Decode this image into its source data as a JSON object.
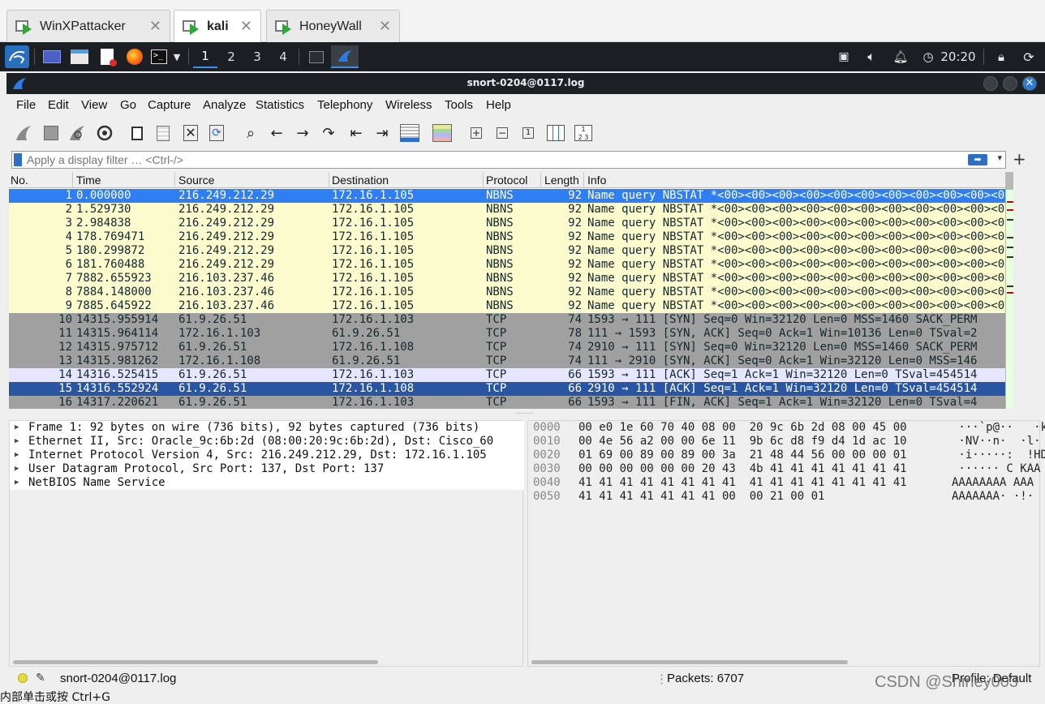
{
  "vm_tabs": [
    {
      "label": "WinXPattacker",
      "active": false
    },
    {
      "label": "kali",
      "active": true
    },
    {
      "label": "HoneyWall",
      "active": false
    }
  ],
  "panel": {
    "workspaces": [
      "1",
      "2",
      "3",
      "4"
    ],
    "active_workspace": "1",
    "clock": "20:20"
  },
  "window": {
    "title": "snort-0204@0117.log"
  },
  "menu": [
    "File",
    "Edit",
    "View",
    "Go",
    "Capture",
    "Analyze",
    "Statistics",
    "Telephony",
    "Wireless",
    "Tools",
    "Help"
  ],
  "filter": {
    "placeholder": "Apply a display filter … <Ctrl-/>",
    "plus": "+"
  },
  "packet_list": {
    "columns": [
      "No.",
      "Time",
      "Source",
      "Destination",
      "Protocol",
      "Length",
      "Info"
    ],
    "rows": [
      {
        "no": "1",
        "time": "0.000000",
        "src": "216.249.212.29",
        "dst": "172.16.1.105",
        "proto": "NBNS",
        "len": "92",
        "info": "Name query NBSTAT *<00><00><00><00><00><00><00><00><00><00><0",
        "style": "selected"
      },
      {
        "no": "2",
        "time": "1.529730",
        "src": "216.249.212.29",
        "dst": "172.16.1.105",
        "proto": "NBNS",
        "len": "92",
        "info": "Name query NBSTAT *<00><00><00><00><00><00><00><00><00><00><0",
        "style": "udp"
      },
      {
        "no": "3",
        "time": "2.984838",
        "src": "216.249.212.29",
        "dst": "172.16.1.105",
        "proto": "NBNS",
        "len": "92",
        "info": "Name query NBSTAT *<00><00><00><00><00><00><00><00><00><00><0",
        "style": "udp"
      },
      {
        "no": "4",
        "time": "178.769471",
        "src": "216.249.212.29",
        "dst": "172.16.1.105",
        "proto": "NBNS",
        "len": "92",
        "info": "Name query NBSTAT *<00><00><00><00><00><00><00><00><00><00><0",
        "style": "udp"
      },
      {
        "no": "5",
        "time": "180.299872",
        "src": "216.249.212.29",
        "dst": "172.16.1.105",
        "proto": "NBNS",
        "len": "92",
        "info": "Name query NBSTAT *<00><00><00><00><00><00><00><00><00><00><0",
        "style": "udp"
      },
      {
        "no": "6",
        "time": "181.760488",
        "src": "216.249.212.29",
        "dst": "172.16.1.105",
        "proto": "NBNS",
        "len": "92",
        "info": "Name query NBSTAT *<00><00><00><00><00><00><00><00><00><00><0",
        "style": "udp"
      },
      {
        "no": "7",
        "time": "7882.655923",
        "src": "216.103.237.46",
        "dst": "172.16.1.105",
        "proto": "NBNS",
        "len": "92",
        "info": "Name query NBSTAT *<00><00><00><00><00><00><00><00><00><00><0",
        "style": "udp"
      },
      {
        "no": "8",
        "time": "7884.148000",
        "src": "216.103.237.46",
        "dst": "172.16.1.105",
        "proto": "NBNS",
        "len": "92",
        "info": "Name query NBSTAT *<00><00><00><00><00><00><00><00><00><00><0",
        "style": "udp"
      },
      {
        "no": "9",
        "time": "7885.645922",
        "src": "216.103.237.46",
        "dst": "172.16.1.105",
        "proto": "NBNS",
        "len": "92",
        "info": "Name query NBSTAT *<00><00><00><00><00><00><00><00><00><00><0",
        "style": "udp"
      },
      {
        "no": "10",
        "time": "14315.955914",
        "src": "61.9.26.51",
        "dst": "172.16.1.103",
        "proto": "TCP",
        "len": "74",
        "info": "1593 → 111 [SYN] Seq=0 Win=32120 Len=0 MSS=1460 SACK_PERM",
        "style": "syn"
      },
      {
        "no": "11",
        "time": "14315.964114",
        "src": "172.16.1.103",
        "dst": "61.9.26.51",
        "proto": "TCP",
        "len": "78",
        "info": "111 → 1593 [SYN, ACK] Seq=0 Ack=1 Win=10136 Len=0 TSval=2",
        "style": "syn"
      },
      {
        "no": "12",
        "time": "14315.975712",
        "src": "61.9.26.51",
        "dst": "172.16.1.108",
        "proto": "TCP",
        "len": "74",
        "info": "2910 → 111 [SYN] Seq=0 Win=32120 Len=0 MSS=1460 SACK_PERM",
        "style": "syn"
      },
      {
        "no": "13",
        "time": "14315.981262",
        "src": "172.16.1.108",
        "dst": "61.9.26.51",
        "proto": "TCP",
        "len": "74",
        "info": "111 → 2910 [SYN, ACK] Seq=0 Ack=1 Win=32120 Len=0 MSS=146",
        "style": "syn"
      },
      {
        "no": "14",
        "time": "14316.525415",
        "src": "61.9.26.51",
        "dst": "172.16.1.103",
        "proto": "TCP",
        "len": "66",
        "info": "1593 → 111 [ACK] Seq=1 Ack=1 Win=32120 Len=0 TSval=454514",
        "style": "tcp"
      },
      {
        "no": "15",
        "time": "14316.552924",
        "src": "61.9.26.51",
        "dst": "172.16.1.108",
        "proto": "TCP",
        "len": "66",
        "info": "2910 → 111 [ACK] Seq=1 Ack=1 Win=32120 Len=0 TSval=454514",
        "style": "dark"
      },
      {
        "no": "16",
        "time": "14317.220621",
        "src": "61.9.26.51",
        "dst": "172.16.1.103",
        "proto": "TCP",
        "len": "66",
        "info": "1593 → 111 [FIN, ACK] Seq=1 Ack=1 Win=32120 Len=0 TSval=4",
        "style": "syn"
      }
    ]
  },
  "details": [
    "Frame 1: 92 bytes on wire (736 bits), 92 bytes captured (736 bits)",
    "Ethernet II, Src: Oracle_9c:6b:2d (08:00:20:9c:6b:2d), Dst: Cisco_60",
    "Internet Protocol Version 4, Src: 216.249.212.29, Dst: 172.16.1.105",
    "User Datagram Protocol, Src Port: 137, Dst Port: 137",
    "NetBIOS Name Service"
  ],
  "bytes": [
    {
      "off": "0000",
      "hex": "00 e0 1e 60 70 40 08 00  20 9c 6b 2d 08 00 45 00",
      "ascii": " ···`p@··   ·k"
    },
    {
      "off": "0010",
      "hex": "00 4e 56 a2 00 00 6e 11  9b 6c d8 f9 d4 1d ac 10",
      "ascii": " ·NV··n·  ·l·"
    },
    {
      "off": "0020",
      "hex": "01 69 00 89 00 89 00 3a  21 48 44 56 00 00 00 01",
      "ascii": " ·i·····:  !HD"
    },
    {
      "off": "0030",
      "hex": "00 00 00 00 00 00 20 43  4b 41 41 41 41 41 41 41",
      "ascii": " ······ C KAA"
    },
    {
      "off": "0040",
      "hex": "41 41 41 41 41 41 41 41  41 41 41 41 41 41 41 41",
      "ascii": "AAAAAAAA AAA"
    },
    {
      "off": "0050",
      "hex": "41 41 41 41 41 41 41 00  00 21 00 01",
      "ascii": "AAAAAAA· ·!·"
    }
  ],
  "status": {
    "file": "snort-0204@0117.log",
    "packets": "Packets: 6707",
    "profile": "Profile: Default"
  },
  "host_caption": "内部单击或按 Ctrl+G",
  "watermark": "CSDN @Shirley003",
  "colors": {
    "selected_bg": "#2f7ef2",
    "udp_bg": "#fcfccf",
    "syn_bg": "#a0a0a0",
    "tcp_bg": "#e7e6ff",
    "dark_bg": "#2a55a3"
  }
}
